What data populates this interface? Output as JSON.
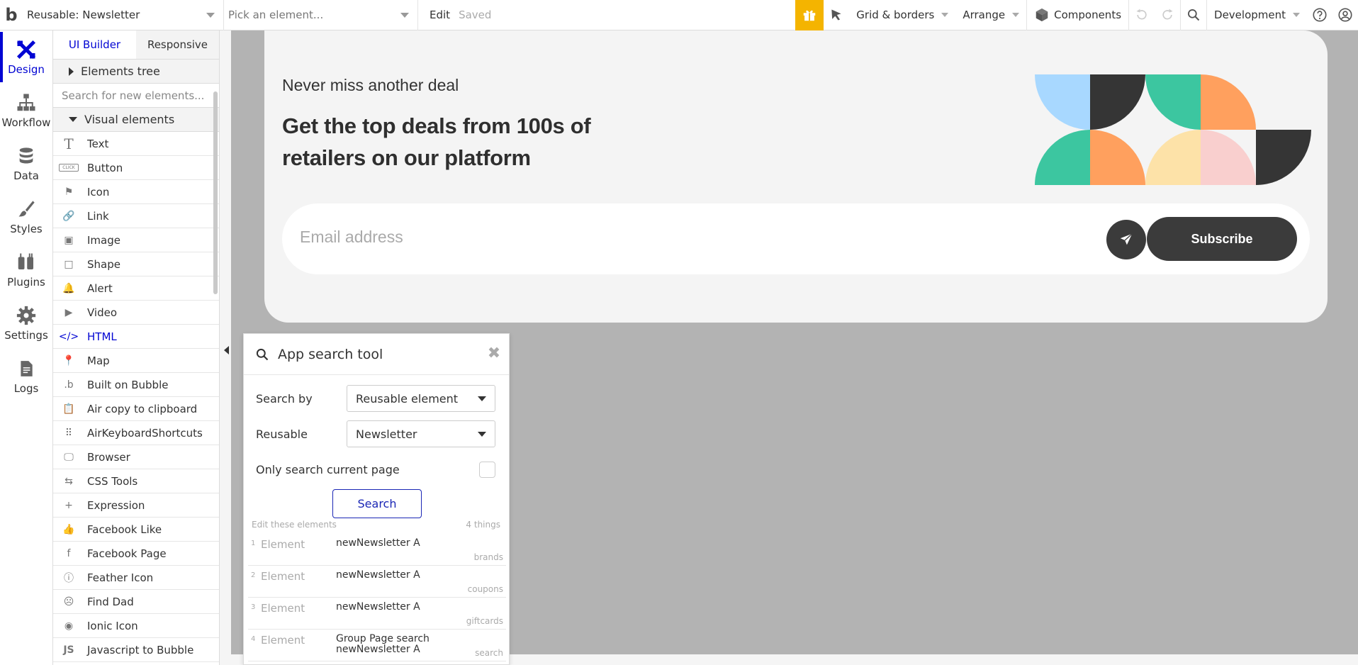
{
  "topbar": {
    "logo": "b",
    "page_select": "Reusable: Newsletter",
    "element_select": "Pick an element...",
    "edit": "Edit",
    "saved": "Saved",
    "grid": "Grid & borders",
    "arrange": "Arrange",
    "components": "Components",
    "environment": "Development"
  },
  "rail": {
    "items": [
      {
        "label": "Design"
      },
      {
        "label": "Workflow"
      },
      {
        "label": "Data"
      },
      {
        "label": "Styles"
      },
      {
        "label": "Plugins"
      },
      {
        "label": "Settings"
      },
      {
        "label": "Logs"
      }
    ]
  },
  "palette": {
    "tabs": [
      "UI Builder",
      "Responsive"
    ],
    "elements_tree": "Elements tree",
    "search_placeholder": "Search for new elements...",
    "visual_elements": "Visual elements",
    "items": [
      {
        "label": "Text",
        "icon": "T"
      },
      {
        "label": "Button",
        "icon": "CLICK"
      },
      {
        "label": "Icon",
        "icon": "⚑"
      },
      {
        "label": "Link",
        "icon": "🔗"
      },
      {
        "label": "Image",
        "icon": "▣"
      },
      {
        "label": "Shape",
        "icon": "□"
      },
      {
        "label": "Alert",
        "icon": "🔔"
      },
      {
        "label": "Video",
        "icon": "▶"
      },
      {
        "label": "HTML",
        "icon": "</>"
      },
      {
        "label": "Map",
        "icon": "📍"
      },
      {
        "label": "Built on Bubble",
        "icon": ".b"
      },
      {
        "label": "Air copy to clipboard",
        "icon": "📋"
      },
      {
        "label": "AirKeyboardShortcuts",
        "icon": "⠿"
      },
      {
        "label": "Browser",
        "icon": "🖵"
      },
      {
        "label": "CSS Tools",
        "icon": "⇆"
      },
      {
        "label": "Expression",
        "icon": "+"
      },
      {
        "label": "Facebook Like",
        "icon": "👍"
      },
      {
        "label": "Facebook Page",
        "icon": "f"
      },
      {
        "label": "Feather Icon",
        "icon": "ⓘ"
      },
      {
        "label": "Find Dad",
        "icon": "☹"
      },
      {
        "label": "Ionic Icon",
        "icon": "◉"
      },
      {
        "label": "Javascript to Bubble",
        "icon": "JS"
      }
    ]
  },
  "newsletter": {
    "eyebrow": "Never miss another deal",
    "heading": "Get the top deals from 100s of retailers on our platform",
    "email_placeholder": "Email address",
    "subscribe": "Subscribe",
    "colors": {
      "light_blue": "#a8d8ff",
      "dark": "#353535",
      "green": "#3cc6a0",
      "orange": "#ffa05e",
      "cream": "#fde2a8",
      "pink": "#f9cfce"
    }
  },
  "search_tool": {
    "title": "App search tool",
    "search_by_label": "Search by",
    "search_by_value": "Reusable element",
    "reusable_label": "Reusable",
    "reusable_value": "Newsletter",
    "only_current_page": "Only search current page",
    "search_button": "Search",
    "edit_these": "Edit these elements",
    "count": "4 things",
    "results": [
      {
        "index": "1",
        "kind": "Element",
        "name": "newNewsletter A",
        "tag": "brands"
      },
      {
        "index": "2",
        "kind": "Element",
        "name": "newNewsletter A",
        "tag": "coupons"
      },
      {
        "index": "3",
        "kind": "Element",
        "name": "newNewsletter A",
        "tag": "giftcards"
      },
      {
        "index": "4",
        "kind": "Element",
        "name": "Group Page search newNewsletter A",
        "tag": "search"
      }
    ]
  }
}
